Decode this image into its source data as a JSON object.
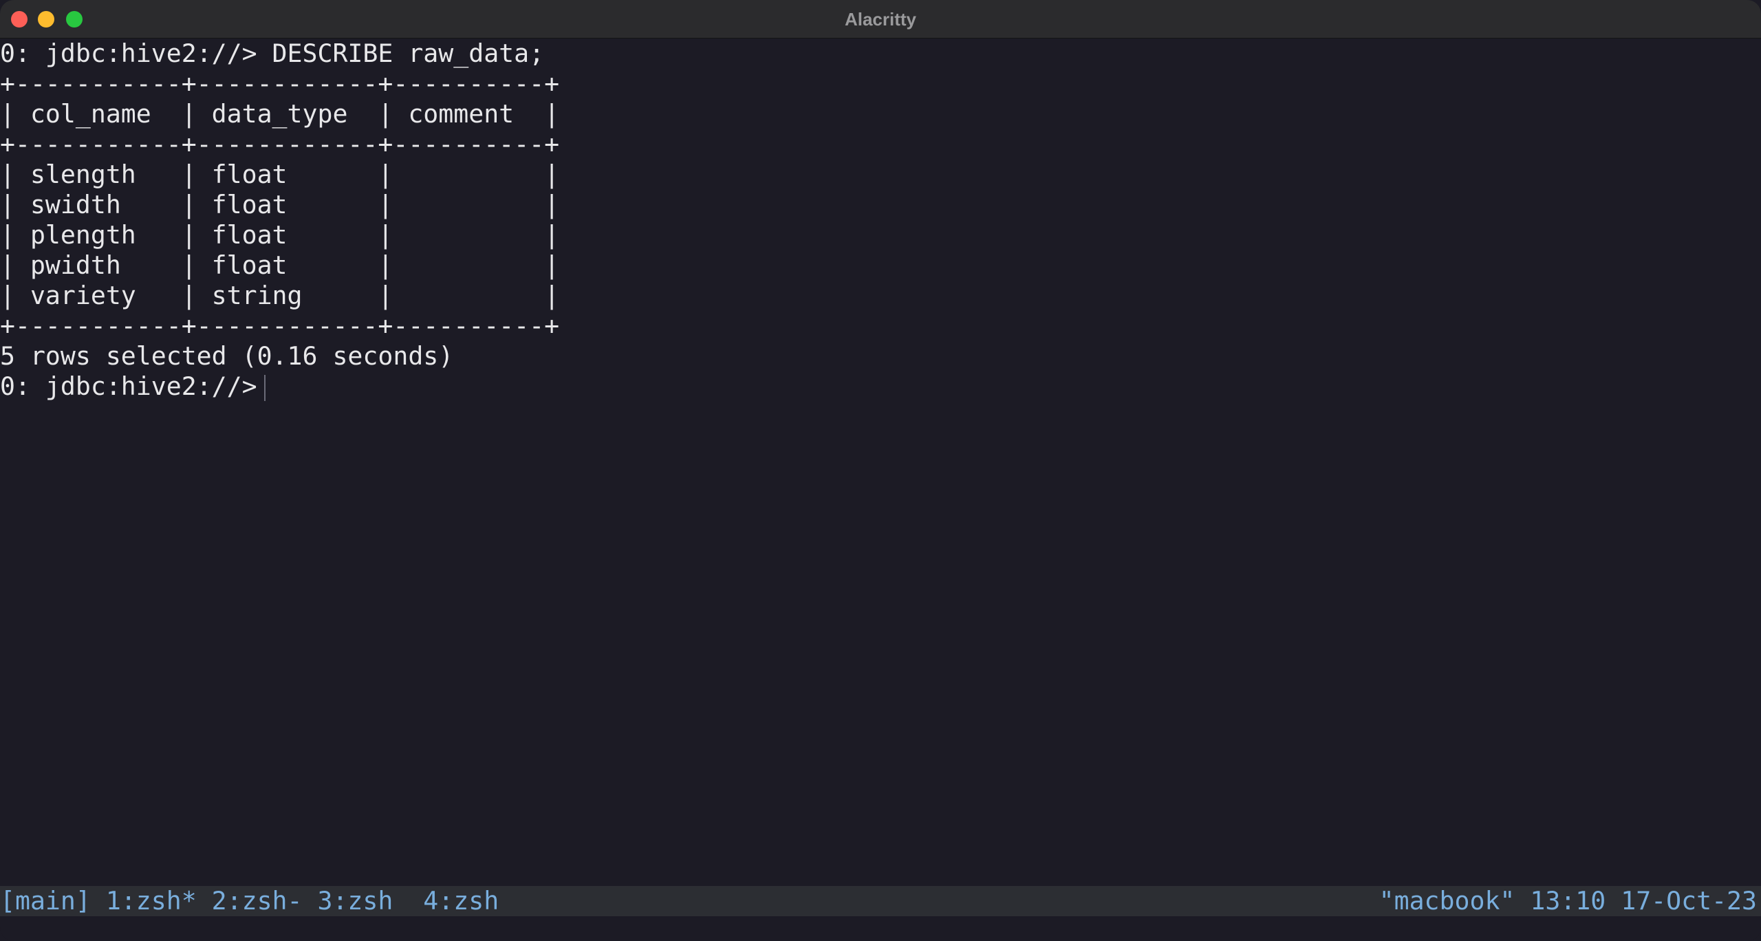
{
  "window": {
    "title": "Alacritty"
  },
  "terminal": {
    "lines": [
      "0: jdbc:hive2://> DESCRIBE raw_data;",
      "+-----------+------------+----------+",
      "| col_name  | data_type  | comment  |",
      "+-----------+------------+----------+",
      "| slength   | float      |          |",
      "| swidth    | float      |          |",
      "| plength   | float      |          |",
      "| pwidth    | float      |          |",
      "| variety   | string     |          |",
      "+-----------+------------+----------+",
      "5 rows selected (0.16 seconds)"
    ],
    "prompt": "0: jdbc:hive2://>"
  },
  "statusbar": {
    "left": "[main] 1:zsh* 2:zsh- 3:zsh  4:zsh",
    "right": "\"macbook\" 13:10 17-Oct-23"
  },
  "colors": {
    "background": "#1c1b25",
    "foreground": "#e8e8ea",
    "status_background": "#2c2e33",
    "status_foreground": "#79aedd"
  }
}
